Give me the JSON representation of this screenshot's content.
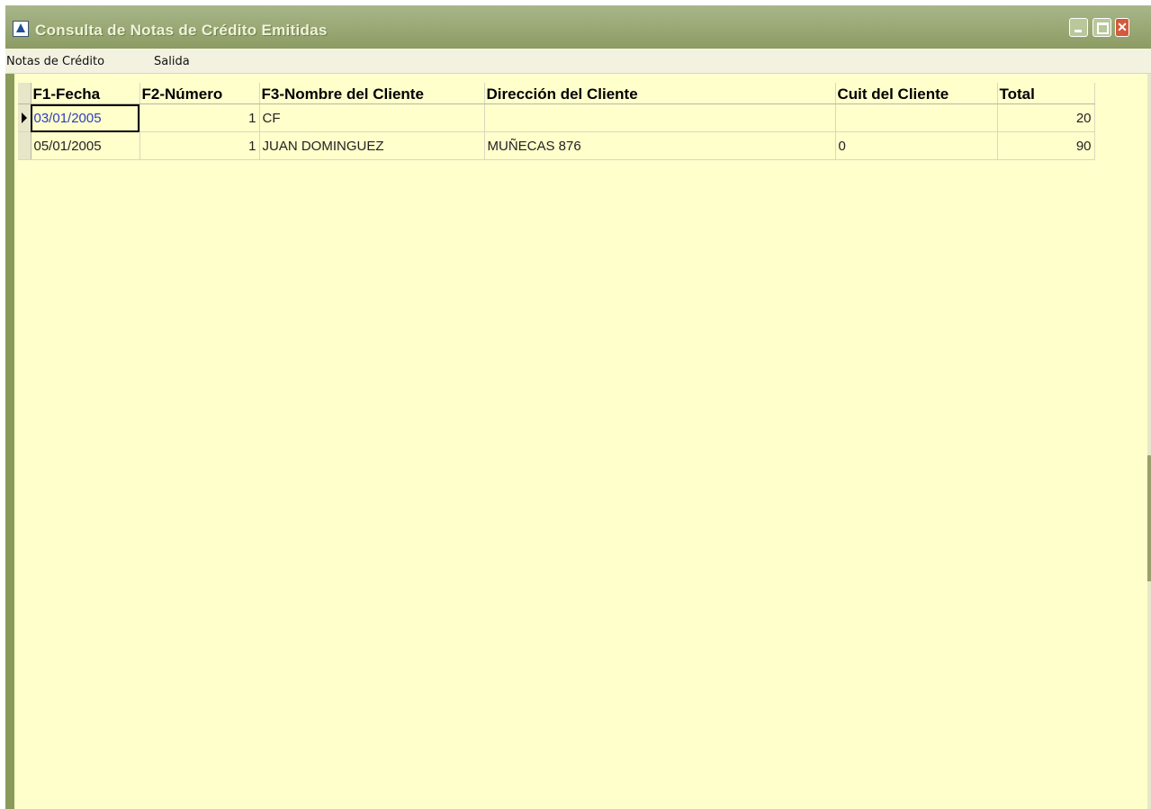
{
  "window": {
    "title": "Consulta de Notas de Crédito Emitidas",
    "close_glyph": "✕"
  },
  "menubar": {
    "items": [
      "Notas de Crédito",
      "Salida"
    ]
  },
  "grid": {
    "columns": [
      "F1-Fecha",
      "F2-Número",
      "F3-Nombre del Cliente",
      "Dirección del Cliente",
      "Cuit del Cliente",
      "Total"
    ],
    "rows": [
      {
        "fecha": "03/01/2005",
        "numero": "1",
        "nombre": "CF",
        "direccion": "",
        "cuit": "",
        "total": "20"
      },
      {
        "fecha": "05/01/2005",
        "numero": "1",
        "nombre": "JUAN DOMINGUEZ",
        "direccion": "MUÑECAS 876",
        "cuit": "0",
        "total": "90"
      }
    ],
    "current_row_index": 0
  },
  "colors": {
    "titlebar": "#8c9c63",
    "background": "#ffffcc",
    "active_cell_text": "#2d3cc0"
  }
}
